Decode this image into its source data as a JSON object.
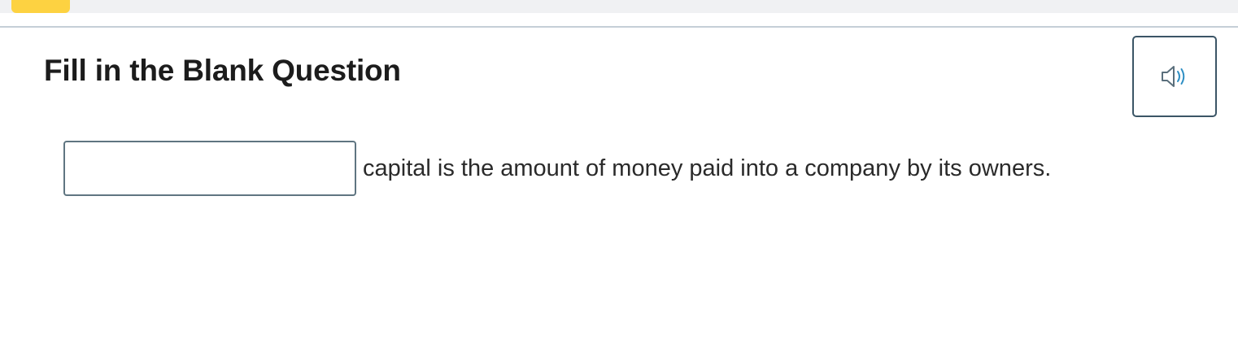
{
  "progress": {
    "fill_color": "#fdd241"
  },
  "question": {
    "title": "Fill in the Blank Question",
    "blank_value": "",
    "sentence_after_blank": "capital is the amount of money paid into a company by its owners."
  },
  "audio_button": {
    "icon": "speaker-icon"
  }
}
